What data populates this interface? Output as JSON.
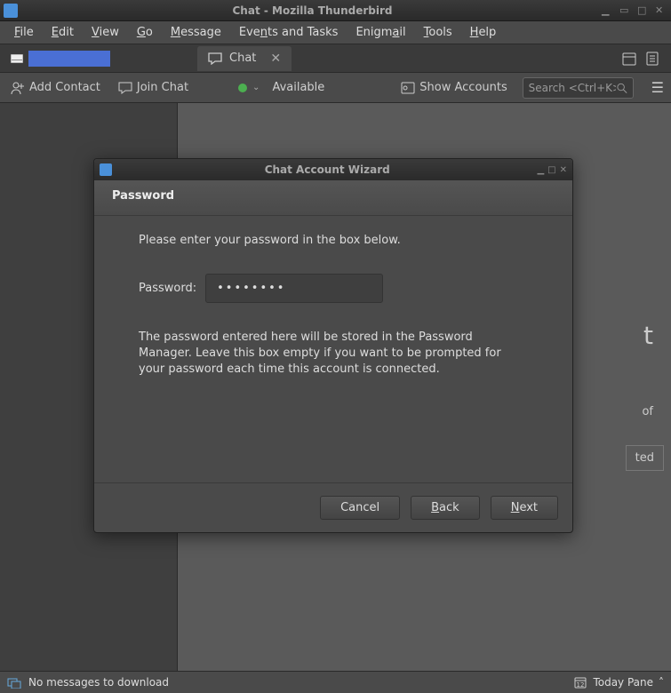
{
  "window": {
    "title": "Chat - Mozilla Thunderbird"
  },
  "menu": {
    "file": "File",
    "edit": "Edit",
    "view": "View",
    "go": "Go",
    "message": "Message",
    "events": "Events and Tasks",
    "enigmail": "Enigmail",
    "tools": "Tools",
    "help": "Help"
  },
  "tabs": {
    "chat_label": "Chat"
  },
  "toolbar": {
    "add_contact": "Add Contact",
    "join_chat": "Join Chat",
    "status_label": "Available",
    "show_accounts": "Show Accounts",
    "search_placeholder": "Search <Ctrl+K>"
  },
  "wizard": {
    "title": "Chat Account Wizard",
    "heading": "Password",
    "instruction": "Please enter your password in the box below.",
    "field_label": "Password:",
    "field_value": "••••••••",
    "note": "The password entered here will be stored in the Password Manager. Leave this box empty if you want to be prompted for your password each time this account is connected.",
    "cancel": "Cancel",
    "back": "Back",
    "next": "Next"
  },
  "statusbar": {
    "message": "No messages to download",
    "today": "Today Pane"
  }
}
